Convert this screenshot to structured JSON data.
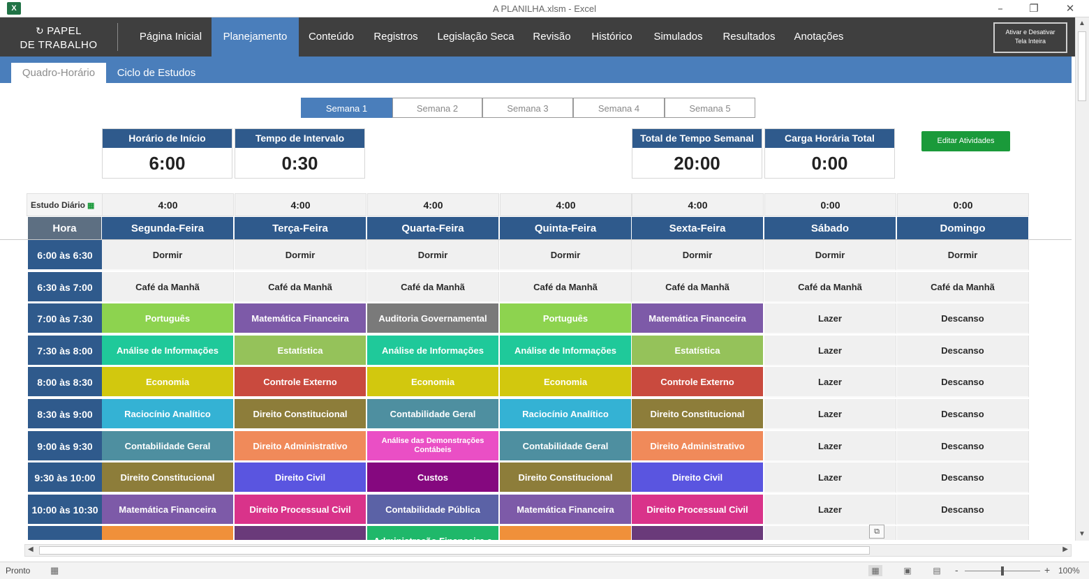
{
  "window": {
    "title": "A PLANILHA.xlsm - Excel",
    "app_icon": "X",
    "minimize": "–",
    "restore": "❐",
    "close": "✕"
  },
  "logo": {
    "line1": "PAPEL",
    "line2": "DE TRABALHO",
    "icon": "↻"
  },
  "nav": {
    "items": [
      "Página Inicial",
      "Planejamento",
      "Conteúdo",
      "Registros",
      "Legislação Seca",
      "Revisão",
      "Histórico",
      "Simulados",
      "Resultados",
      "Anotações"
    ],
    "active": "Planejamento",
    "toggle_line1": "Ativar e Desativar",
    "toggle_line2": "Tela Inteira"
  },
  "subnav": {
    "tabs": [
      "Quadro-Horário",
      "Ciclo de Estudos"
    ],
    "active": "Quadro-Horário"
  },
  "weeks": {
    "tabs": [
      "Semana 1",
      "Semana 2",
      "Semana 3",
      "Semana 4",
      "Semana 5"
    ],
    "active": "Semana 1"
  },
  "stats": {
    "start_time": {
      "label": "Horário de Início",
      "value": "6:00"
    },
    "interval": {
      "label": "Tempo de Intervalo",
      "value": "0:30"
    },
    "weekly_total": {
      "label": "Total de Tempo Semanal",
      "value": "20:00"
    },
    "total_load": {
      "label": "Carga Horária Total",
      "value": "0:00"
    }
  },
  "edit_button": "Editar Atividades",
  "daily": {
    "label": "Estudo Diário",
    "values": [
      "4:00",
      "4:00",
      "4:00",
      "4:00",
      "4:00",
      "0:00",
      "0:00"
    ]
  },
  "table": {
    "hour_header": "Hora",
    "days": [
      "Segunda-Feira",
      "Terça-Feira",
      "Quarta-Feira",
      "Quinta-Feira",
      "Sexta-Feira",
      "Sábado",
      "Domingo"
    ],
    "rows": [
      {
        "time": "6:00  às  6:30",
        "cells": [
          {
            "t": "Dormir",
            "c": ""
          },
          {
            "t": "Dormir",
            "c": ""
          },
          {
            "t": "Dormir",
            "c": ""
          },
          {
            "t": "Dormir",
            "c": ""
          },
          {
            "t": "Dormir",
            "c": ""
          },
          {
            "t": "Dormir",
            "c": ""
          },
          {
            "t": "Dormir",
            "c": ""
          }
        ]
      },
      {
        "time": "6:30  às  7:00",
        "cells": [
          {
            "t": "Café da Manhã",
            "c": ""
          },
          {
            "t": "Café da Manhã",
            "c": ""
          },
          {
            "t": "Café da Manhã",
            "c": ""
          },
          {
            "t": "Café da Manhã",
            "c": ""
          },
          {
            "t": "Café da Manhã",
            "c": ""
          },
          {
            "t": "Café da Manhã",
            "c": ""
          },
          {
            "t": "Café da Manhã",
            "c": ""
          }
        ]
      },
      {
        "time": "7:00  às  7:30",
        "cells": [
          {
            "t": "Português",
            "c": "#8dd34f"
          },
          {
            "t": "Matemática Financeira",
            "c": "#7d5aa8"
          },
          {
            "t": "Auditoria Governamental",
            "c": "#7a7a7a"
          },
          {
            "t": "Português",
            "c": "#8dd34f"
          },
          {
            "t": "Matemática Financeira",
            "c": "#7d5aa8"
          },
          {
            "t": "Lazer",
            "c": ""
          },
          {
            "t": "Descanso",
            "c": ""
          }
        ]
      },
      {
        "time": "7:30  às  8:00",
        "cells": [
          {
            "t": "Análise de Informações",
            "c": "#1fc99a"
          },
          {
            "t": "Estatística",
            "c": "#95c25a"
          },
          {
            "t": "Análise de Informações",
            "c": "#1fc99a"
          },
          {
            "t": "Análise de Informações",
            "c": "#1fc99a"
          },
          {
            "t": "Estatística",
            "c": "#95c25a"
          },
          {
            "t": "Lazer",
            "c": ""
          },
          {
            "t": "Descanso",
            "c": ""
          }
        ]
      },
      {
        "time": "8:00  às  8:30",
        "cells": [
          {
            "t": "Economia",
            "c": "#d2c80e"
          },
          {
            "t": "Controle Externo",
            "c": "#c94a3e"
          },
          {
            "t": "Economia",
            "c": "#d2c80e"
          },
          {
            "t": "Economia",
            "c": "#d2c80e"
          },
          {
            "t": "Controle Externo",
            "c": "#c94a3e"
          },
          {
            "t": "Lazer",
            "c": ""
          },
          {
            "t": "Descanso",
            "c": ""
          }
        ]
      },
      {
        "time": "8:30  às  9:00",
        "cells": [
          {
            "t": "Raciocínio Analítico",
            "c": "#34b2d4"
          },
          {
            "t": "Direito Constitucional",
            "c": "#8d7d3a"
          },
          {
            "t": "Contabilidade Geral",
            "c": "#4e8fa0"
          },
          {
            "t": "Raciocínio Analítico",
            "c": "#34b2d4"
          },
          {
            "t": "Direito Constitucional",
            "c": "#8d7d3a"
          },
          {
            "t": "Lazer",
            "c": ""
          },
          {
            "t": "Descanso",
            "c": ""
          }
        ]
      },
      {
        "time": "9:00  às  9:30",
        "cells": [
          {
            "t": "Contabilidade Geral",
            "c": "#4e8fa0"
          },
          {
            "t": "Direito Administrativo",
            "c": "#f08a5a"
          },
          {
            "t": "Análise das Demonstrações Contábeis",
            "c": "#ea4fc5"
          },
          {
            "t": "Contabilidade Geral",
            "c": "#4e8fa0"
          },
          {
            "t": "Direito Administrativo",
            "c": "#f08a5a"
          },
          {
            "t": "Lazer",
            "c": ""
          },
          {
            "t": "Descanso",
            "c": ""
          }
        ]
      },
      {
        "time": "9:30  às 10:00",
        "cells": [
          {
            "t": "Direito Constitucional",
            "c": "#8d7d3a"
          },
          {
            "t": "Direito Civil",
            "c": "#5a55e0"
          },
          {
            "t": "Custos",
            "c": "#85087f"
          },
          {
            "t": "Direito Constitucional",
            "c": "#8d7d3a"
          },
          {
            "t": "Direito Civil",
            "c": "#5a55e0"
          },
          {
            "t": "Lazer",
            "c": ""
          },
          {
            "t": "Descanso",
            "c": ""
          }
        ]
      },
      {
        "time": "10:00 às 10:30",
        "cells": [
          {
            "t": "Matemática Financeira",
            "c": "#7d5aa8"
          },
          {
            "t": "Direito Processual Civil",
            "c": "#d9338a"
          },
          {
            "t": "Contabilidade Pública",
            "c": "#5b62a6"
          },
          {
            "t": "Matemática Financeira",
            "c": "#7d5aa8"
          },
          {
            "t": "Direito Processual Civil",
            "c": "#d9338a"
          },
          {
            "t": "Lazer",
            "c": ""
          },
          {
            "t": "Descanso",
            "c": ""
          }
        ]
      },
      {
        "time": "",
        "cells": [
          {
            "t": "",
            "c": "#f0903a"
          },
          {
            "t": "",
            "c": "#6a3a7a"
          },
          {
            "t": "Administração Financeira e",
            "c": "#1fb86a"
          },
          {
            "t": "",
            "c": "#f0903a"
          },
          {
            "t": "",
            "c": "#6a3a7a"
          },
          {
            "t": "",
            "c": ""
          },
          {
            "t": "",
            "c": ""
          }
        ]
      }
    ]
  },
  "colors": {
    "nav_bg": "#3f3f3f",
    "accent_blue": "#4a7ebb",
    "header_blue": "#2f5a8c",
    "excel_green": "#217346",
    "button_green": "#1a9a3a"
  },
  "status": {
    "ready": "Pronto",
    "macro_icon": "▦",
    "zoom_minus": "-",
    "zoom_plus": "+",
    "zoom": "100%"
  },
  "icons": {
    "cell_mode": "⧉",
    "calendar": "▦",
    "normal_view": "▦",
    "page_layout": "▣",
    "page_break": "▤",
    "scroll_up": "▲",
    "scroll_down": "▼",
    "scroll_left": "◀",
    "scroll_right": "▶"
  }
}
